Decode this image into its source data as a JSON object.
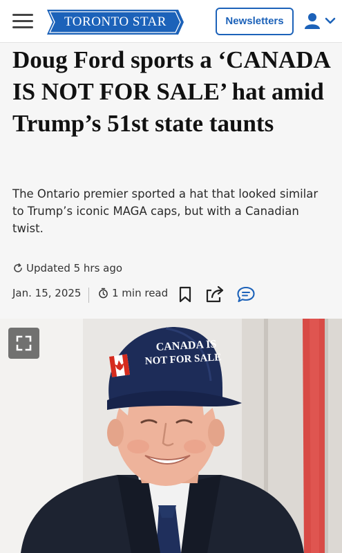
{
  "header": {
    "logo_text": "TORONTO STAR",
    "newsletters_label": "Newsletters",
    "menu_icon": "hamburger-menu-icon",
    "account_icon": "user-icon",
    "brand_color": "#1c62b9"
  },
  "article": {
    "headline": "Doug Ford sports a ‘CANADA IS NOT FOR SALE’ hat amid Trump’s 51st state taunts",
    "dek": "The Ontario premier sported a hat that looked similar to Trump’s iconic MAGA caps, but with a Canadian twist.",
    "updated": "Updated 5 hrs ago",
    "date": "Jan. 15, 2025",
    "read_time": "1 min read",
    "icons": [
      "clock-icon",
      "bookmark-icon",
      "share-icon",
      "comment-icon"
    ],
    "accent_color": "#1c62b9"
  },
  "photo": {
    "hat_text_line1": "CANADA IS",
    "hat_text_line2": "NOT FOR SALE",
    "expand_icon": "expand-icon"
  }
}
